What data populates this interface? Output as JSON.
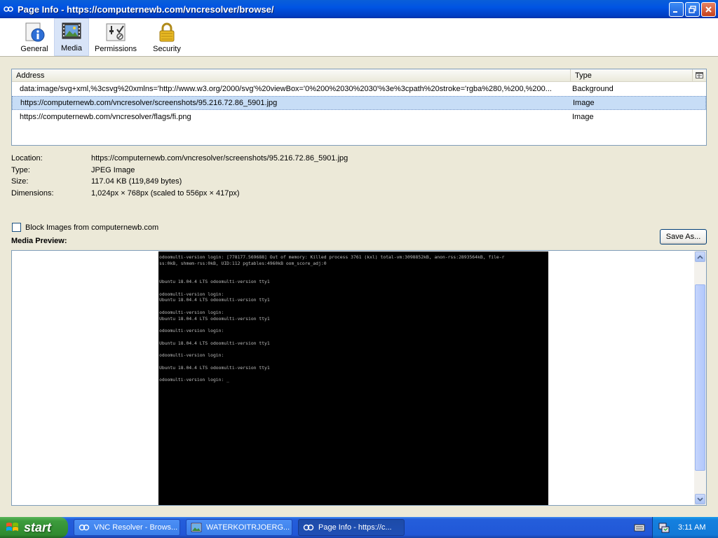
{
  "window": {
    "title": "Page Info - https://computernewb.com/vncresolver/browse/"
  },
  "toolbar": {
    "tabs": [
      {
        "label": "General",
        "icon": "info-icon"
      },
      {
        "label": "Media",
        "icon": "media-icon"
      },
      {
        "label": "Permissions",
        "icon": "permissions-icon"
      },
      {
        "label": "Security",
        "icon": "lock-icon"
      }
    ],
    "active": "Media"
  },
  "media_table": {
    "columns": [
      "Address",
      "Type"
    ],
    "rows": [
      {
        "address": "data:image/svg+xml,%3csvg%20xmlns='http://www.w3.org/2000/svg'%20viewBox='0%200%2030%2030'%3e%3cpath%20stroke='rgba%280,%200,%200...",
        "type": "Background"
      },
      {
        "address": "https://computernewb.com/vncresolver/screenshots/95.216.72.86_5901.jpg",
        "type": "Image"
      },
      {
        "address": "https://computernewb.com/vncresolver/flags/fi.png",
        "type": "Image"
      }
    ],
    "selected_index": 1
  },
  "details": {
    "location_label": "Location:",
    "location": "https://computernewb.com/vncresolver/screenshots/95.216.72.86_5901.jpg",
    "type_label": "Type:",
    "type": "JPEG Image",
    "size_label": "Size:",
    "size": "117.04 KB (119,849 bytes)",
    "dimensions_label": "Dimensions:",
    "dimensions": "1,024px × 768px (scaled to 556px × 417px)"
  },
  "block_images": {
    "label": "Block Images from computernewb.com",
    "checked": false
  },
  "save_as_label": "Save As...",
  "preview": {
    "title": "Media Preview:",
    "terminal_lines": [
      "odoomulti-version login: [778177.569688] Out of memory: Killed process 3761 (kxl) total-vm:3098852kB, anon-rss:2893564kB, file-r",
      "ss:0kB, shmem-rss:0kB, UID:112 pgtables:4960kB oom_score_adj:0",
      "",
      "",
      "Ubuntu 18.04.4 LTS odoomulti-version tty1",
      "",
      "odoomulti-version login:",
      "Ubuntu 18.04.4 LTS odoomulti-version tty1",
      "",
      "odoomulti-version login:",
      "Ubuntu 18.04.4 LTS odoomulti-version tty1",
      "",
      "odoomulti-version login:",
      "",
      "Ubuntu 18.04.4 LTS odoomulti-version tty1",
      "",
      "odoomulti-version login:",
      "",
      "Ubuntu 18.04.4 LTS odoomulti-version tty1",
      "",
      "odoomulti-version login: _"
    ]
  },
  "taskbar": {
    "start_label": "start",
    "tasks": [
      {
        "label": "VNC Resolver - Brows...",
        "icon": "browser-icon",
        "active": false
      },
      {
        "label": "WATERKOITRJOERG...",
        "icon": "image-icon",
        "active": false
      },
      {
        "label": "Page Info - https://c...",
        "icon": "browser-icon",
        "active": true
      }
    ],
    "clock": "3:11 AM"
  }
}
